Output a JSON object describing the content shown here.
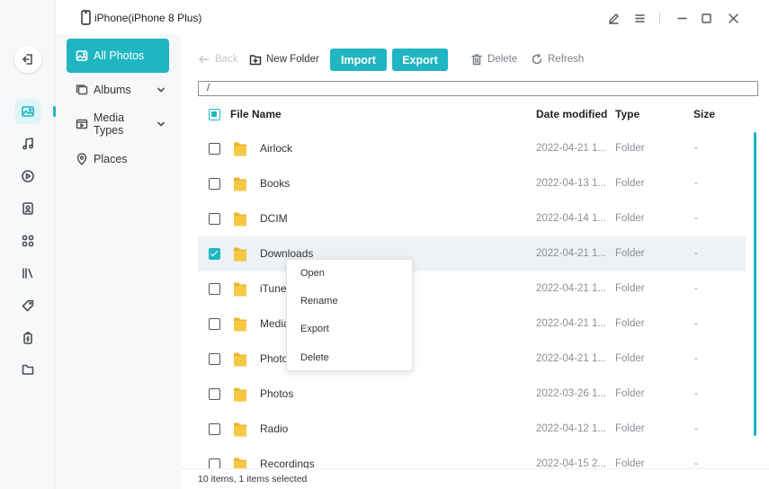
{
  "colors": {
    "accent": "#1fb6c2",
    "folder": "#f6c844",
    "rail_bg": "#f7f8fa"
  },
  "titlebar": {
    "device_name": "iPhone(iPhone 8 Plus)",
    "icons": [
      "edit-icon",
      "menu-icon",
      "minimize-icon",
      "maximize-icon",
      "close-icon"
    ]
  },
  "rail": {
    "items": [
      "back-icon",
      "photos-icon",
      "music-icon",
      "video-icon",
      "contacts-icon",
      "apps-icon",
      "books-icon",
      "tag-icon",
      "battery-icon",
      "files-icon"
    ],
    "active": "photos-icon"
  },
  "sidebar": {
    "items": [
      {
        "label": "All Photos",
        "icon": "photo-icon",
        "active": true
      },
      {
        "label": "Albums",
        "icon": "albums-icon",
        "expandable": true
      },
      {
        "label": "Media Types",
        "icon": "media-types-icon",
        "expandable": true
      },
      {
        "label": "Places",
        "icon": "location-icon"
      }
    ]
  },
  "toolbar": {
    "back_label": "Back",
    "new_folder_label": "New Folder",
    "import_label": "Import",
    "export_label": "Export",
    "delete_label": "Delete",
    "refresh_label": "Refresh"
  },
  "path": "/",
  "table": {
    "columns": {
      "name": "File Name",
      "date": "Date modified",
      "type": "Type",
      "size": "Size"
    },
    "rows": [
      {
        "name": "Airlock",
        "date": "2022-04-21 1...",
        "type": "Folder",
        "size": "-",
        "checked": false
      },
      {
        "name": "Books",
        "date": "2022-04-13 1...",
        "type": "Folder",
        "size": "-",
        "checked": false
      },
      {
        "name": "DCIM",
        "date": "2022-04-14 1...",
        "type": "Folder",
        "size": "-",
        "checked": false
      },
      {
        "name": "Downloads",
        "date": "2022-04-21 1...",
        "type": "Folder",
        "size": "-",
        "checked": true
      },
      {
        "name": "iTune",
        "date": "2022-04-21 1...",
        "type": "Folder",
        "size": "-",
        "checked": false
      },
      {
        "name": "Media",
        "date": "2022-04-21 1...",
        "type": "Folder",
        "size": "-",
        "checked": false
      },
      {
        "name": "Photo",
        "date": "2022-04-21 1...",
        "type": "Folder",
        "size": "-",
        "checked": false
      },
      {
        "name": "Photos",
        "date": "2022-03-26 1...",
        "type": "Folder",
        "size": "-",
        "checked": false
      },
      {
        "name": "Radio",
        "date": "2022-04-12 1...",
        "type": "Folder",
        "size": "-",
        "checked": false
      },
      {
        "name": "Recordings",
        "date": "2022-04-15 2...",
        "type": "Folder",
        "size": "-",
        "checked": false
      }
    ]
  },
  "context_menu": {
    "items": [
      "Open",
      "Rename",
      "Export",
      "Delete"
    ]
  },
  "status": "10 items, 1 items selected"
}
